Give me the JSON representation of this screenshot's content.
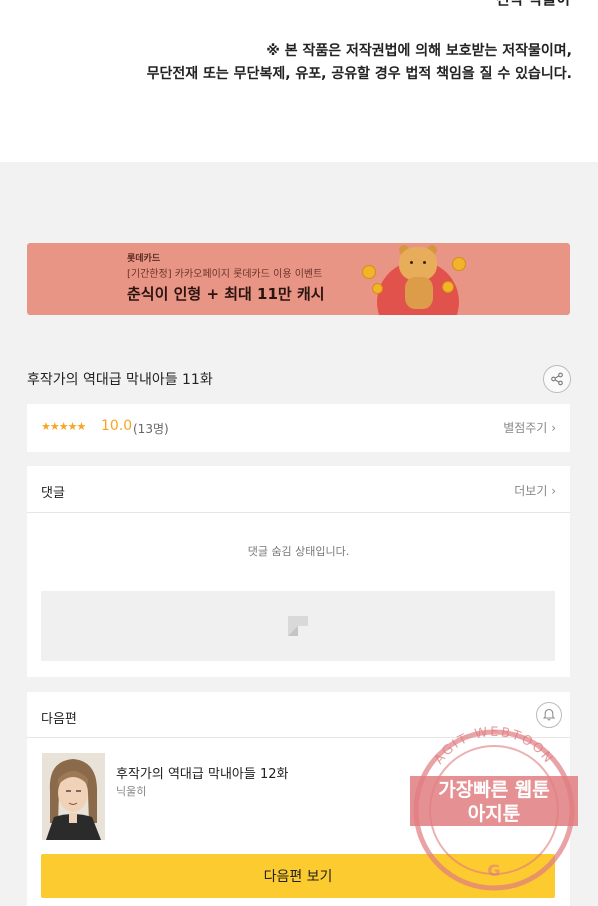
{
  "header": {
    "cut_title": "전작 작물이",
    "copyright_line1": "※ 본 작품은 저작권법에 의해 보호받는 저작물이며,",
    "copyright_line2": "무단전재 또는 무단복제, 유포, 공유할 경우 법적 책임을 질 수 있습니다."
  },
  "banner": {
    "brand": "롯데카드",
    "sub": "[기간한정] 카카오페이지 롯데카드 이용 이벤트",
    "headline": "춘식이 인형 + 최대 11만 캐시",
    "colors": {
      "background": "#e99585",
      "circle": "#e2524c",
      "coin": "#f2b42a"
    }
  },
  "episode": {
    "title": "후작가의 역대급 막내아들 11화",
    "share_icon": "share-icon"
  },
  "rating": {
    "stars": "★★★★★",
    "score": "10.0",
    "voters": "(13명)",
    "rate_label": "별점주기",
    "rate_chevron": "›",
    "star_color": "#f5a623"
  },
  "comments": {
    "title": "댓글",
    "more_label": "더보기",
    "more_chevron": "›",
    "hidden_message": "댓글 숨김 상태입니다."
  },
  "next": {
    "section_title": "다음편",
    "episode_title": "후작가의 역대급 막내아들 12화",
    "author": "닉울히",
    "button_label": "다음편 보기",
    "button_color": "#fccb2f"
  },
  "watermark": {
    "arc_text": "AGIT WEBTOON",
    "line1": "가장빠른 웹툰",
    "line2": "아지툰",
    "letter": "G"
  }
}
